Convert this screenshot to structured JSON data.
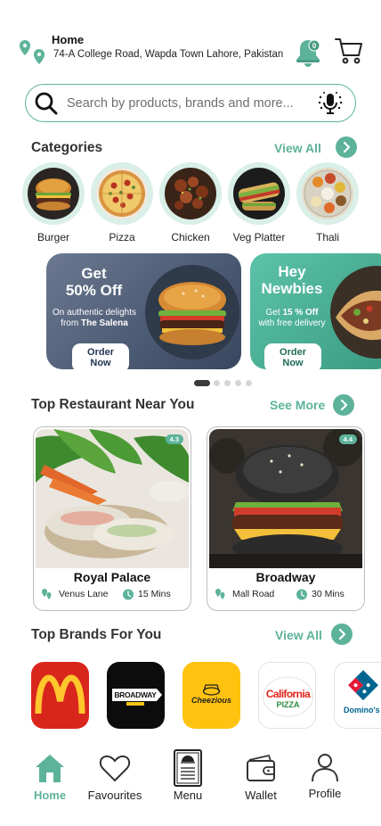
{
  "header": {
    "location_title": "Home",
    "location_address": "74-A College Road, Wapda Town Lahore, Pakistan",
    "notification_count": "0"
  },
  "search": {
    "placeholder": "Search by products, brands and more..."
  },
  "categories": {
    "title": "Categories",
    "view_all": "View All",
    "items": [
      {
        "label": "Burger",
        "icon": "burger-image"
      },
      {
        "label": "Pizza",
        "icon": "pizza-image"
      },
      {
        "label": "Chicken",
        "icon": "chicken-image"
      },
      {
        "label": "Veg Platter",
        "icon": "veg-platter-image"
      },
      {
        "label": "Thali",
        "icon": "thali-image"
      }
    ]
  },
  "banners": [
    {
      "title_line1": "Get",
      "title_line2": "50% Off",
      "sub_line1": "On authentic delights",
      "sub_line2_prefix": "from ",
      "sub_line2_bold": "The Salena",
      "button": "Order Now"
    },
    {
      "title_line1": "Hey",
      "title_line2": "Newbies",
      "sub_line1_prefix": "Get ",
      "sub_line1_bold": "15 % Off",
      "sub_line2": "with free delivery",
      "button": "Order Now"
    }
  ],
  "carousel": {
    "total": 5,
    "active_index": 0
  },
  "restaurants": {
    "title": "Top Restaurant Near You",
    "see_more": "See More",
    "items": [
      {
        "name": "Royal Palace",
        "location": "Venus Lane",
        "time": "15 Mins",
        "rating": "4.3"
      },
      {
        "name": "Broadway",
        "location": "Mall Road",
        "time": "30 Mins",
        "rating": "4.4"
      }
    ]
  },
  "brands": {
    "title": "Top Brands For You",
    "view_all": "View All",
    "items": [
      {
        "name": "McDonald's",
        "logo_text": ""
      },
      {
        "name": "Broadway",
        "logo_text": "BROADWAY"
      },
      {
        "name": "Cheezious",
        "logo_text": "Cheezious"
      },
      {
        "name": "California Pizza",
        "logo_text_1": "California",
        "logo_text_2": "PIZZA"
      },
      {
        "name": "Domino's",
        "logo_text": "Domino's"
      }
    ]
  },
  "nav": [
    {
      "label": "Home",
      "icon": "home-icon",
      "active": true
    },
    {
      "label": "Favourites",
      "icon": "heart-icon",
      "active": false
    },
    {
      "label": "Menu",
      "icon": "menu-icon",
      "active": false
    },
    {
      "label": "Wallet",
      "icon": "wallet-icon",
      "active": false
    },
    {
      "label": "Profile",
      "icon": "profile-icon",
      "active": false
    }
  ],
  "colors": {
    "accent": "#5db39a",
    "accent_light": "#d9efe8",
    "banner1": "#4b5a73",
    "banner2": "#3a9a82"
  }
}
